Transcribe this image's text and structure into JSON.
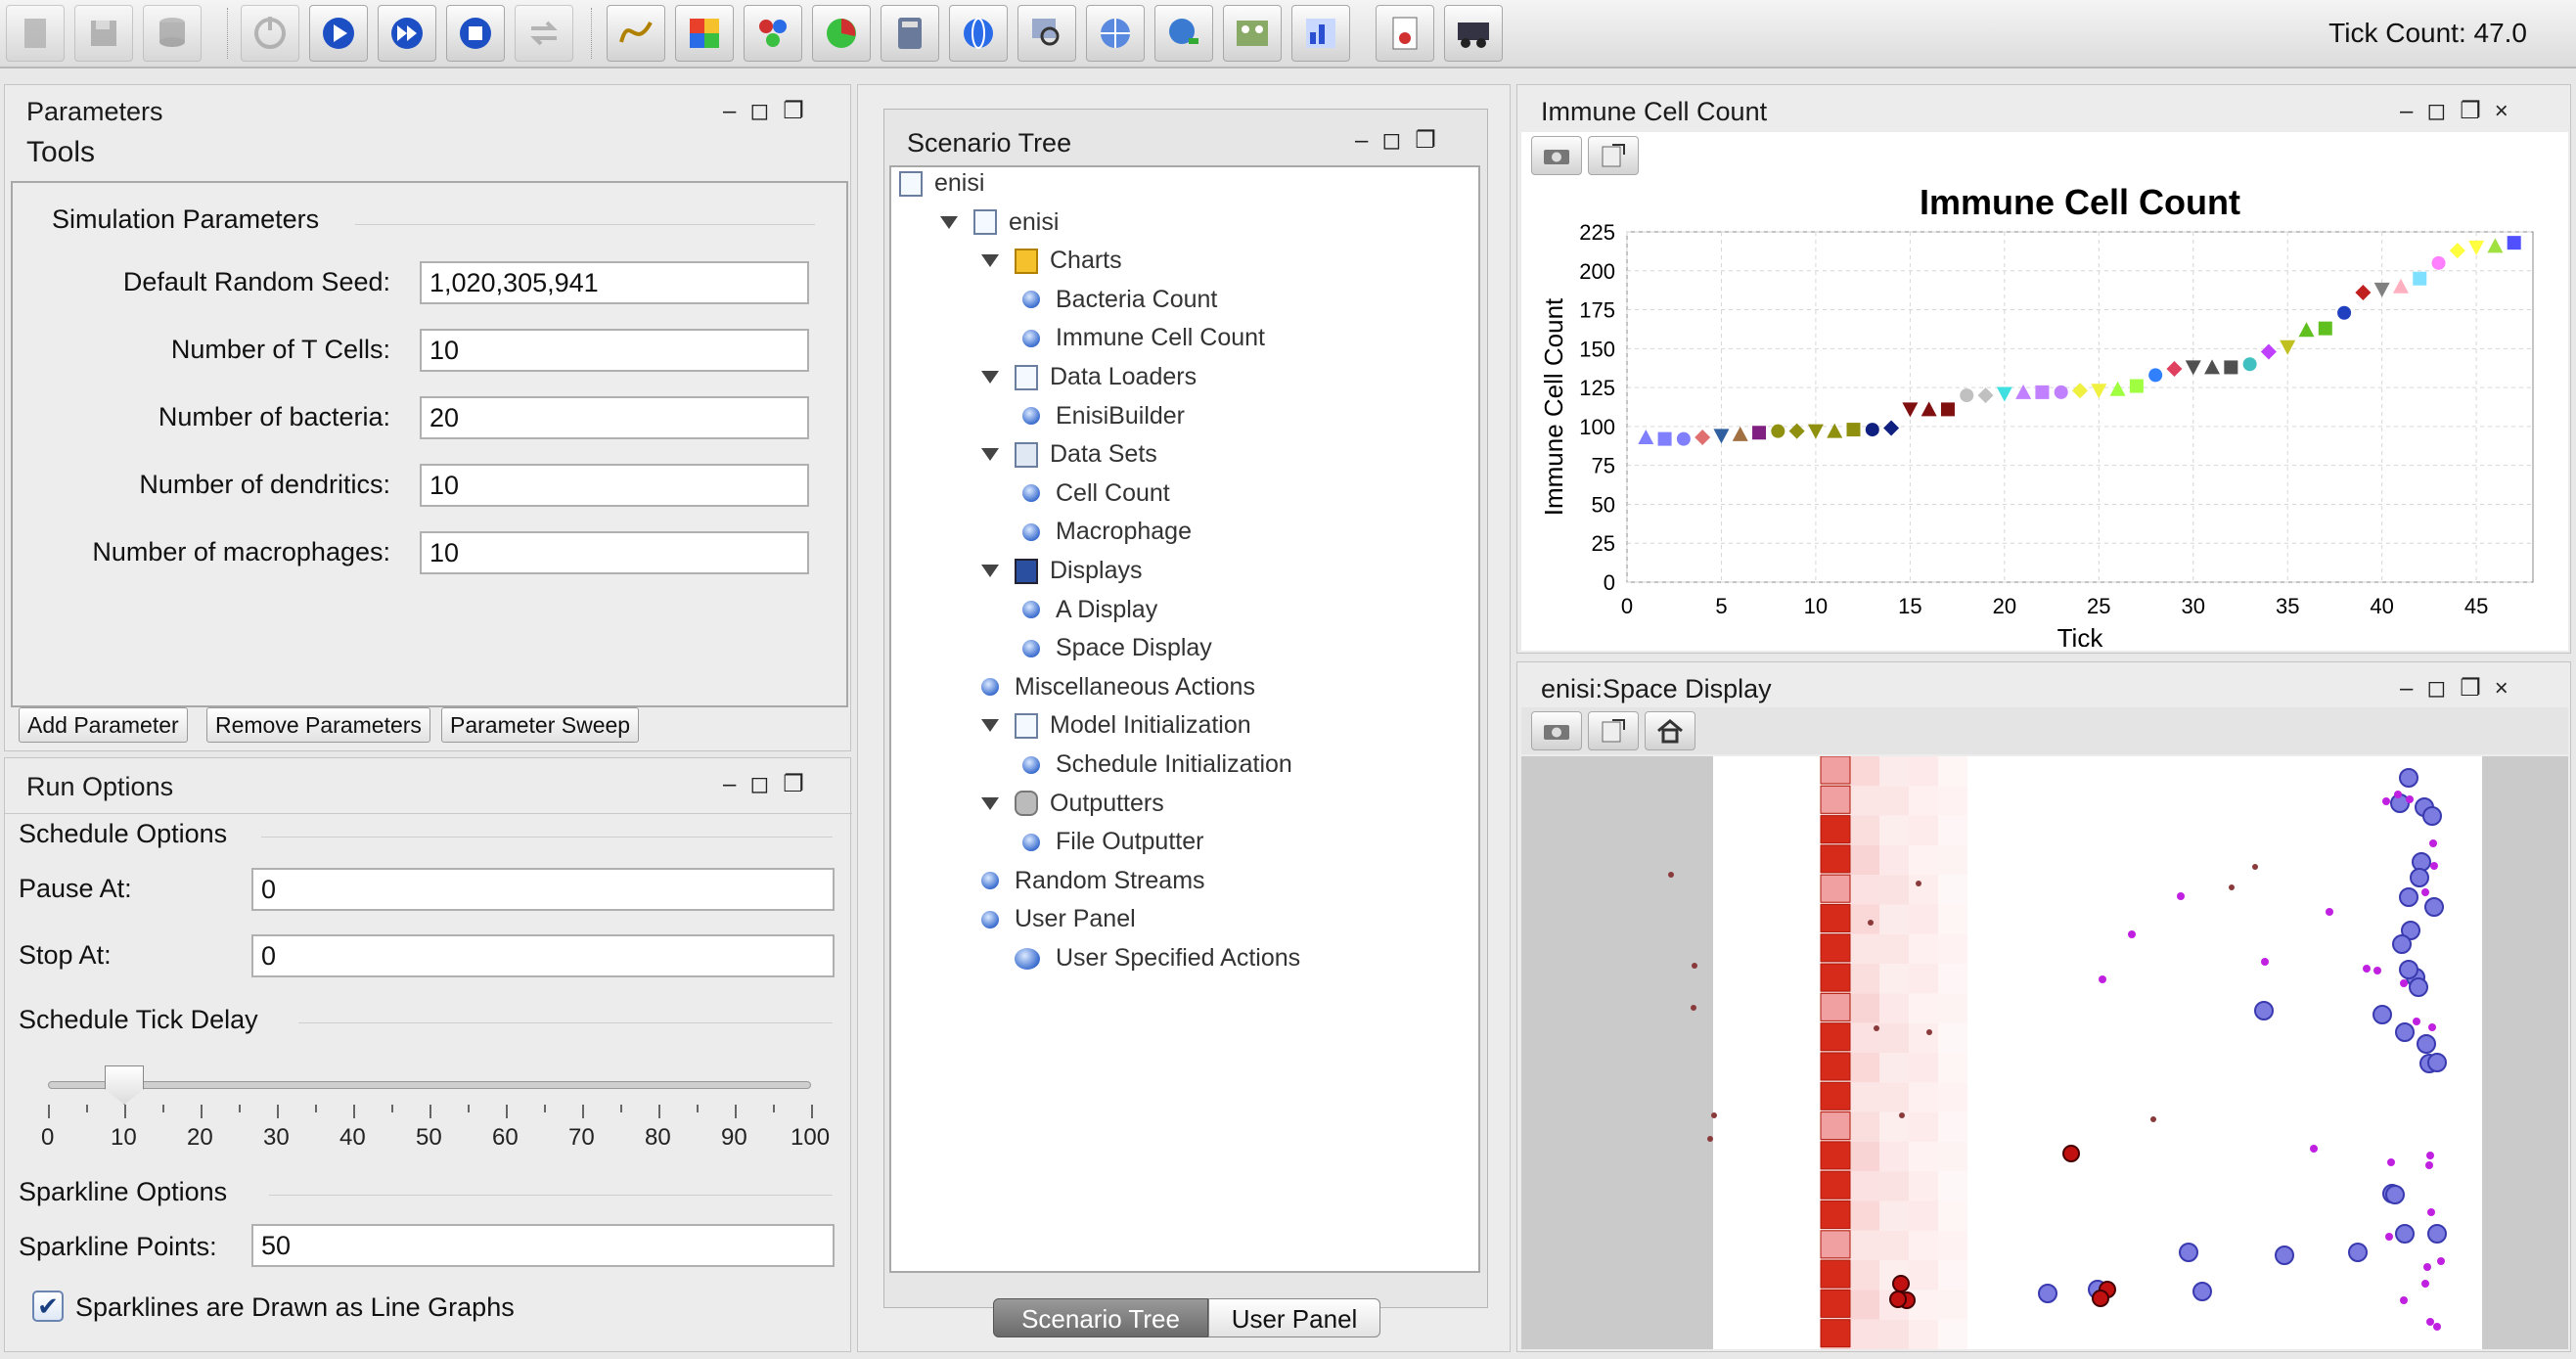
{
  "toolbar": {
    "tick_count": "Tick Count: 47.0",
    "buttons": [
      "load-model-icon",
      "save-icon",
      "database-icon",
      "init-icon",
      "start-icon",
      "step-icon",
      "stop-icon",
      "reset-icon",
      "chart-icon",
      "heatmap-icon",
      "network-icon",
      "pie-icon",
      "calculator-icon",
      "globe-icon",
      "zoom-icon",
      "web-icon",
      "globe-search-icon",
      "gallery-icon",
      "display-icon",
      "report-icon",
      "truck-icon"
    ]
  },
  "params": {
    "title": "Parameters",
    "subtitle": "Tools",
    "group": "Simulation Parameters",
    "fields": [
      {
        "label": "Default Random Seed:",
        "value": "1,020,305,941"
      },
      {
        "label": "Number of T Cells:",
        "value": "10"
      },
      {
        "label": "Number of bacteria:",
        "value": "20"
      },
      {
        "label": "Number of dendritics:",
        "value": "10"
      },
      {
        "label": "Number of macrophages:",
        "value": "10"
      }
    ],
    "buttons": {
      "add": "Add Parameter",
      "remove": "Remove Parameters",
      "sweep": "Parameter Sweep"
    }
  },
  "run": {
    "title": "Run Options",
    "schedule_group": "Schedule Options",
    "pause_label": "Pause At:",
    "pause_value": "0",
    "stop_label": "Stop At:",
    "stop_value": "0",
    "delay_group": "Schedule Tick Delay",
    "delay_value": 10,
    "slider_labels": [
      "0",
      "10",
      "20",
      "30",
      "40",
      "50",
      "60",
      "70",
      "80",
      "90",
      "100"
    ],
    "spark_group": "Sparkline Options",
    "spark_label": "Sparkline Points:",
    "spark_value": "50",
    "spark_check": "Sparklines are Drawn as Line Graphs",
    "spark_checked": true
  },
  "tree": {
    "title": "Scenario Tree",
    "rows": [
      {
        "t": "enisi",
        "lvl": 0,
        "icon": "doc"
      },
      {
        "t": "enisi",
        "lvl": 1,
        "icon": "doc",
        "exp": true
      },
      {
        "t": "Charts",
        "lvl": 2,
        "icon": "charts",
        "exp": true
      },
      {
        "t": "Bacteria Count",
        "lvl": 3,
        "icon": "bullet"
      },
      {
        "t": "Immune Cell Count",
        "lvl": 3,
        "icon": "bullet"
      },
      {
        "t": "Data Loaders",
        "lvl": 2,
        "icon": "doc",
        "exp": true
      },
      {
        "t": "EnisiBuilder",
        "lvl": 3,
        "icon": "bullet"
      },
      {
        "t": "Data Sets",
        "lvl": 2,
        "icon": "datasets",
        "exp": true
      },
      {
        "t": "Cell Count",
        "lvl": 3,
        "icon": "bullet"
      },
      {
        "t": "Macrophage",
        "lvl": 3,
        "icon": "bullet"
      },
      {
        "t": "Displays",
        "lvl": 2,
        "icon": "monitor",
        "exp": true
      },
      {
        "t": "A Display",
        "lvl": 3,
        "icon": "bullet"
      },
      {
        "t": "Space Display",
        "lvl": 3,
        "icon": "bullet"
      },
      {
        "t": "Miscellaneous Actions",
        "lvl": 2,
        "icon": "bullet"
      },
      {
        "t": "Model Initialization",
        "lvl": 2,
        "icon": "doc",
        "exp": true
      },
      {
        "t": "Schedule Initialization",
        "lvl": 3,
        "icon": "bullet"
      },
      {
        "t": "Outputters",
        "lvl": 2,
        "icon": "db",
        "exp": true
      },
      {
        "t": "File Outputter",
        "lvl": 3,
        "icon": "bullet"
      },
      {
        "t": "Random Streams",
        "lvl": 2,
        "icon": "bullet"
      },
      {
        "t": "User Panel",
        "lvl": 2,
        "icon": "bullet"
      },
      {
        "t": "User Specified Actions",
        "lvl": 2,
        "icon": "usa"
      }
    ],
    "tabs": [
      "Scenario Tree",
      "User Panel"
    ]
  },
  "chart_panel": {
    "title": "Immune Cell Count"
  },
  "space_panel": {
    "title": "enisi:Space Display"
  },
  "chart_data": {
    "type": "scatter",
    "title": "Immune Cell Count",
    "xlabel": "Tick",
    "ylabel": "Immune Cell Count",
    "xlim": [
      0,
      48
    ],
    "ylim": [
      0,
      225
    ],
    "xticks": [
      0,
      5,
      10,
      15,
      20,
      25,
      30,
      35,
      40,
      45
    ],
    "yticks": [
      0,
      25,
      50,
      75,
      100,
      125,
      150,
      175,
      200,
      225
    ],
    "grid": true,
    "x": [
      1,
      2,
      3,
      4,
      5,
      6,
      7,
      8,
      9,
      10,
      11,
      12,
      13,
      14,
      15,
      16,
      17,
      18,
      19,
      20,
      21,
      22,
      23,
      24,
      25,
      26,
      27,
      28,
      29,
      30,
      31,
      32,
      33,
      34,
      35,
      36,
      37,
      38,
      39,
      40,
      41,
      42,
      43,
      44,
      45,
      46,
      47
    ],
    "y": [
      93,
      92,
      92,
      93,
      94,
      95,
      96,
      97,
      97,
      97,
      97,
      98,
      98,
      99,
      111,
      111,
      111,
      120,
      120,
      121,
      122,
      122,
      122,
      123,
      123,
      124,
      126,
      133,
      137,
      138,
      138,
      138,
      140,
      148,
      151,
      162,
      163,
      173,
      186,
      188,
      190,
      195,
      205,
      213,
      215,
      216,
      218
    ],
    "colors": [
      "#8080ff",
      "#8080ff",
      "#8080ff",
      "#e07070",
      "#3060a0",
      "#a07040",
      "#802080",
      "#909010",
      "#909010",
      "#909010",
      "#909010",
      "#909010",
      "#102080",
      "#102080",
      "#801010",
      "#801010",
      "#801010",
      "#c0c0c0",
      "#c0c0c0",
      "#40e0e0",
      "#c080ff",
      "#c080ff",
      "#c080ff",
      "#f0f040",
      "#f0f040",
      "#a0ff40",
      "#a0ff40",
      "#3080ff",
      "#e04060",
      "#505050",
      "#505050",
      "#505050",
      "#40c0c0",
      "#c040ff",
      "#c0c020",
      "#60c020",
      "#60c020",
      "#2040c0",
      "#c02020",
      "#808080",
      "#ffb0c0",
      "#80e0ff",
      "#ff80ff",
      "#ffff40",
      "#ffff40",
      "#a0e040",
      "#5050ff"
    ]
  }
}
